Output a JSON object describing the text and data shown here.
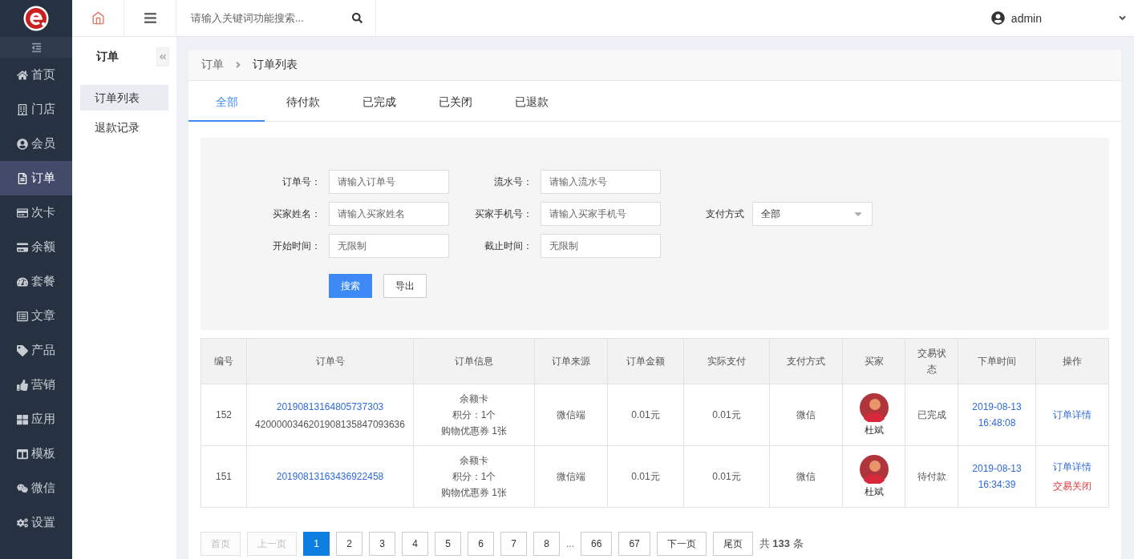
{
  "nav": {
    "items": [
      {
        "label": "首页",
        "selected": false
      },
      {
        "label": "门店",
        "selected": false
      },
      {
        "label": "会员",
        "selected": false
      },
      {
        "label": "订单",
        "selected": true
      },
      {
        "label": "次卡",
        "selected": false
      },
      {
        "label": "余额",
        "selected": false
      },
      {
        "label": "套餐",
        "selected": false
      },
      {
        "label": "文章",
        "selected": false
      },
      {
        "label": "产品",
        "selected": false
      },
      {
        "label": "营销",
        "selected": false
      },
      {
        "label": "应用",
        "selected": false
      },
      {
        "label": "模板",
        "selected": false
      },
      {
        "label": "微信",
        "selected": false
      },
      {
        "label": "设置",
        "selected": false
      }
    ]
  },
  "topbar": {
    "search": {
      "placeholder": "请输入关键词功能搜索..."
    },
    "user": "admin"
  },
  "submenu": {
    "title": "订单",
    "items": [
      {
        "label": "订单列表",
        "selected": true
      },
      {
        "label": "退款记录",
        "selected": false
      }
    ]
  },
  "breadcrumb": [
    "订单",
    "订单列表"
  ],
  "tabs": [
    {
      "label": "全部",
      "selected": true
    },
    {
      "label": "待付款",
      "selected": false
    },
    {
      "label": "已完成",
      "selected": false
    },
    {
      "label": "已关闭",
      "selected": false
    },
    {
      "label": "已退款",
      "selected": false
    }
  ],
  "filters": {
    "rows": [
      [
        {
          "label": "订单号：",
          "placeholder": "请输入订单号"
        },
        {
          "label": "流水号：",
          "placeholder": "请输入流水号"
        }
      ],
      [
        {
          "label": "买家姓名：",
          "placeholder": "请输入买家姓名"
        },
        {
          "label": "买家手机号：",
          "placeholder": "请输入买家手机号"
        },
        {
          "label": "支付方式",
          "value": "全部",
          "kind": "select"
        }
      ],
      [
        {
          "label": "开始时间：",
          "placeholder": "无限制"
        },
        {
          "label": "截止时间：",
          "placeholder": "无限制"
        }
      ]
    ],
    "buttons": [
      {
        "label": "搜索",
        "kind": "primary"
      },
      {
        "label": "导出",
        "kind": "default"
      }
    ]
  },
  "table": {
    "columns": [
      "编号",
      "订单号",
      "订单信息",
      "订单来源",
      "订单金额",
      "实际支付",
      "支付方式",
      "买家",
      "交易状态",
      "下单时间",
      "操作"
    ],
    "rows": [
      {
        "id": "152",
        "order_no": "20190813164805737303",
        "trade_no": "4200000346201908135847093636",
        "info": [
          "余额卡",
          "积分：1个",
          "购物优惠券 1张"
        ],
        "source": "微信端",
        "amount": "0.01元",
        "paid": "0.01元",
        "pay_method": "微信",
        "buyer": "杜斌",
        "status": "已完成",
        "time": [
          "2019-08-13",
          "16:48:08"
        ],
        "actions": [
          {
            "label": "订单详情",
            "kind": "link"
          }
        ]
      },
      {
        "id": "151",
        "order_no": "20190813163436922458",
        "info": [
          "余额卡",
          "积分：1个",
          "购物优惠券 1张"
        ],
        "source": "微信端",
        "amount": "0.01元",
        "paid": "0.01元",
        "pay_method": "微信",
        "buyer": "杜斌",
        "status": "待付款",
        "time": [
          "2019-08-13",
          "16:34:39"
        ],
        "actions": [
          {
            "label": "订单详情",
            "kind": "link"
          },
          {
            "label": "交易关闭",
            "kind": "danger"
          }
        ]
      }
    ]
  },
  "pagination": {
    "items": [
      {
        "label": "首页",
        "kind": "nav",
        "disabled": true
      },
      {
        "label": "上一页",
        "kind": "nav",
        "disabled": true
      },
      {
        "label": "1",
        "kind": "page",
        "selected": true
      },
      {
        "label": "2",
        "kind": "page",
        "selected": false
      },
      {
        "label": "3",
        "kind": "page",
        "selected": false
      },
      {
        "label": "4",
        "kind": "page",
        "selected": false
      },
      {
        "label": "5",
        "kind": "page",
        "selected": false
      },
      {
        "label": "6",
        "kind": "page",
        "selected": false
      },
      {
        "label": "7",
        "kind": "page",
        "selected": false
      },
      {
        "label": "8",
        "kind": "page",
        "selected": false
      },
      {
        "label": "...",
        "kind": "ellipsis"
      },
      {
        "label": "66",
        "kind": "page",
        "selected": false
      },
      {
        "label": "67",
        "kind": "page",
        "selected": false
      },
      {
        "label": "下一页",
        "kind": "nav",
        "disabled": false
      },
      {
        "label": "尾页",
        "kind": "nav",
        "disabled": false
      }
    ],
    "total": "共 **133** 条"
  }
}
